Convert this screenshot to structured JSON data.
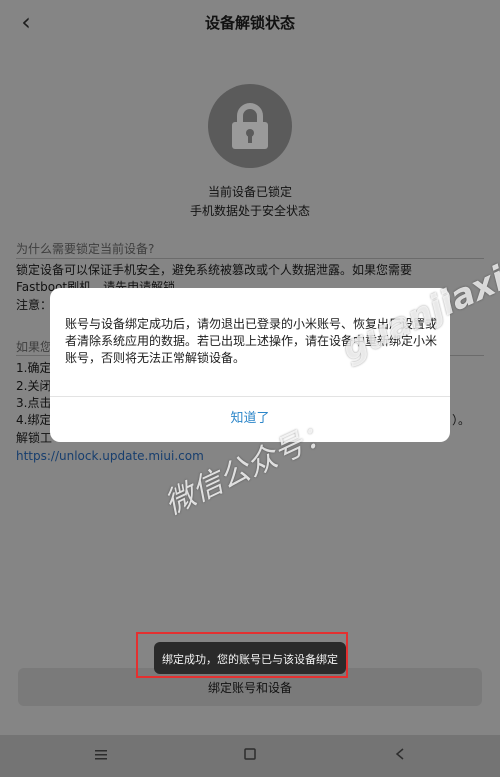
{
  "header": {
    "title": "设备解锁状态",
    "back_icon": "chevron-left-icon"
  },
  "lock": {
    "icon": "lock-icon",
    "status_line1": "当前设备已锁定",
    "status_line2": "手机数据处于安全状态"
  },
  "why": {
    "title": "为什么需要锁定当前设备?",
    "lines": [
      "锁定设备可以保证手机安全，避免系统被篡改或个人数据泄露。如果您需要",
      "Fastboot刷机，请先申请解锁。",
      "注意："
    ]
  },
  "howto": {
    "title": "如果您",
    "lines": [
      "1.确定",
      "2.关闭",
      "3.点击",
      "4.绑定",
      "解锁工"
    ],
    "line4_suffix": "）。",
    "link": "https://unlock.update.miui.com"
  },
  "dialog": {
    "message": "账号与设备绑定成功后，请勿退出已登录的小米账号、恢复出厂设置或者清除系统应用的数据。若已出现上述操作，请在设备中重新绑定小米账号，否则将无法正常解锁设备。",
    "button": "知道了"
  },
  "watermark": {
    "line1": "guanjiaxia",
    "line2": "微信公众号："
  },
  "bind_button": "绑定账号和设备",
  "toast": "绑定成功，您的账号已与该设备绑定",
  "navbar": {
    "menu_icon": "menu-icon",
    "home_icon": "home-square-icon",
    "back_icon": "back-triangle-icon"
  },
  "colors": {
    "accent": "#2c86c9",
    "toast_bg": "#2a2a2a",
    "highlight": "#e43030"
  }
}
